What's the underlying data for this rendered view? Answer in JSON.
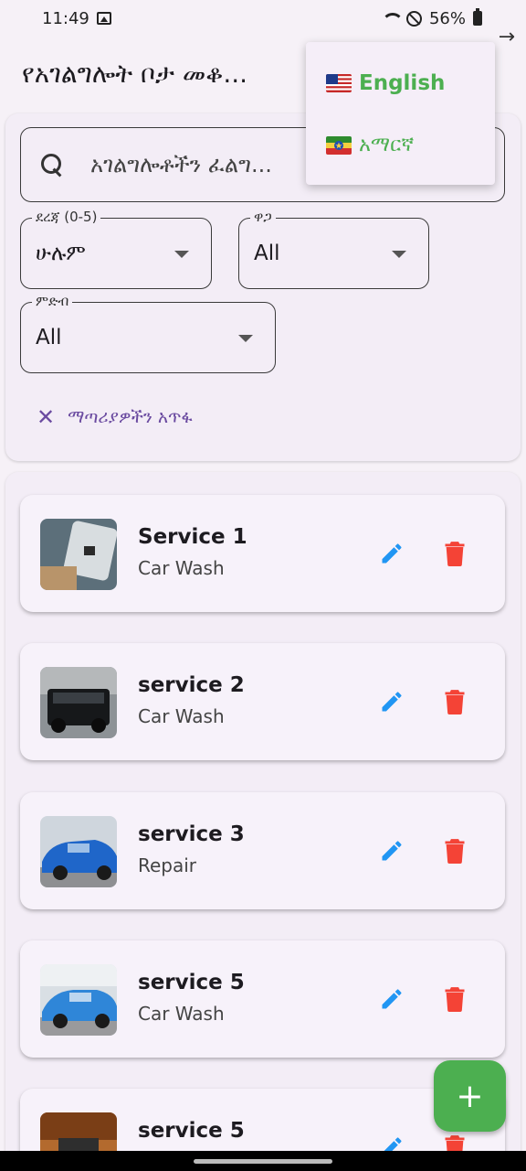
{
  "status_bar": {
    "time": "11:49",
    "battery": "56%"
  },
  "app_bar": {
    "title": "የአገልግሎት ቦታ መቆ...",
    "action_icon": "arrow-right-icon"
  },
  "search": {
    "placeholder": "አገልግሎቶችን ፈልግ..."
  },
  "filters": {
    "rating": {
      "label": "ደረጃ (0-5)",
      "value": "ሁሉም"
    },
    "price": {
      "label": "ዋጋ",
      "value": "All"
    },
    "category": {
      "label": "ምድብ",
      "value": "All"
    },
    "clear_label": "ማጣሪያዎችን አጥፋ"
  },
  "services": [
    {
      "title": "Service 1",
      "category": "Car Wash"
    },
    {
      "title": "service 2",
      "category": "Car Wash"
    },
    {
      "title": "service 3",
      "category": "Repair"
    },
    {
      "title": "service 5",
      "category": "Car Wash"
    },
    {
      "title": "service 5",
      "category": ""
    }
  ],
  "language_menu": {
    "items": [
      {
        "label": "English",
        "flag": "us-flag-icon"
      },
      {
        "label": "አማርኛ",
        "flag": "ethiopia-flag-icon"
      }
    ]
  },
  "fab": {
    "label": "+"
  },
  "colors": {
    "accent_green": "#4caf50",
    "edit_blue": "#2196f3",
    "delete_red": "#f44336",
    "clear_purple": "#6a4aa0"
  }
}
